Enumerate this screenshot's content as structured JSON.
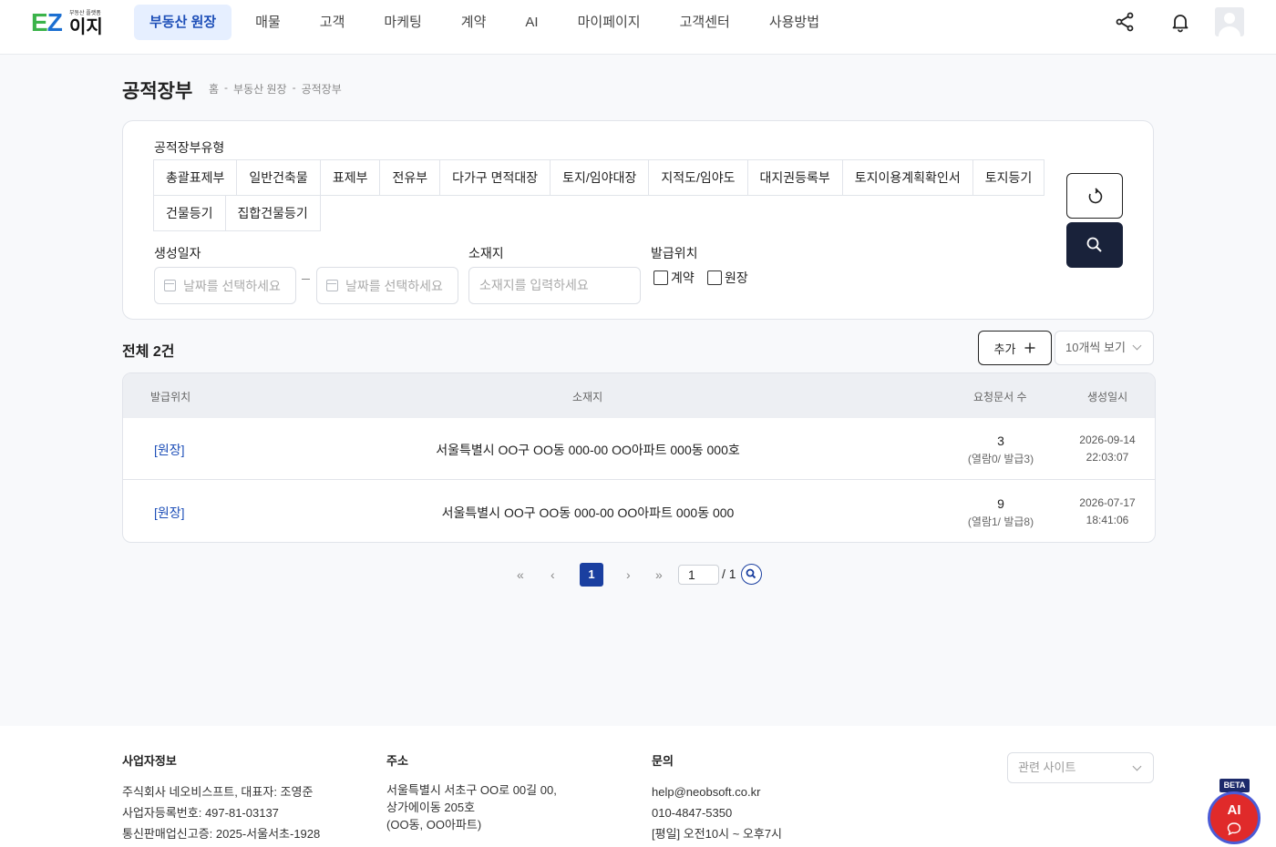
{
  "logo": {
    "en": "EZ",
    "ko": "이지",
    "tagline": "부동산 플랫폼"
  },
  "nav": [
    "부동산 원장",
    "매물",
    "고객",
    "마케팅",
    "계약",
    "AI",
    "마이페이지",
    "고객센터",
    "사용방법"
  ],
  "header_icons": [
    "share-icon",
    "bell-icon",
    "avatar-icon"
  ],
  "page": {
    "title": "공적장부",
    "breadcrumb": [
      "홈",
      "-",
      "부동산 원장",
      "-",
      "공적장부"
    ]
  },
  "filters": {
    "type_label": "공적장부유형",
    "types_row1": [
      "총괄표제부",
      "일반건축물",
      "표제부",
      "전유부",
      "다가구 면적대장",
      "토지/임야대장",
      "지적도/임야도",
      "대지권등록부",
      "토지이용계획확인서",
      "토지등기"
    ],
    "types_row2": [
      "건물등기",
      "집합건물등기"
    ],
    "date_label": "생성일자",
    "date_placeholder": "날짜를 선택하세요",
    "location_label": "소재지",
    "location_placeholder": "소재지를 입력하세요",
    "issue_label": "발급위치",
    "issue_options": [
      "계약",
      "원장"
    ]
  },
  "list": {
    "total": "전체 2건",
    "add_label": "추가",
    "page_size": "10개씩 보기"
  },
  "table": {
    "headers": [
      "발급위치",
      "소재지",
      "요청문서 수",
      "생성일시"
    ],
    "rows": [
      {
        "location": "[원장]",
        "address": "서울특별시 OO구 OO동 000-00 OO아파트 000동 000호",
        "count": "3",
        "count_detail": "(열람0/ 발급3)",
        "date": "2026-09-14",
        "time": "22:03:07"
      },
      {
        "location": "[원장]",
        "address": "서울특별시 OO구 OO동 000-00 OO아파트 000동 000",
        "count": "9",
        "count_detail": "(열람1/ 발급8)",
        "date": "2026-07-17",
        "time": "18:41:06"
      }
    ]
  },
  "pagination": {
    "first": "«",
    "prev": "‹",
    "current": "1",
    "next": "›",
    "last": "»",
    "input": "1",
    "of": "/ 1"
  },
  "footer": {
    "business_head": "사업자정보",
    "business_lines": [
      "주식회사 네오비스프트, 대표자: 조영준",
      "사업자등록번호: 497-81-03137",
      "통신판매업신고증: 2025-서울서초-1928"
    ],
    "address_head": "주소",
    "address_lines": [
      "서울특별시 서초구 OO로 00길 00,",
      "상가에이동 205호",
      "(OO동, OO아파트)"
    ],
    "contact_head": "문의",
    "contact_lines": [
      "help@neobsoft.co.kr",
      "010-4847-5350",
      "[평일] 오전10시 ~ 오후7시"
    ],
    "related_sites": "관련 사이트"
  },
  "ai_widget": {
    "badge": "BETA",
    "label": "AI"
  },
  "colors": {
    "brand_green": "#3bb34a",
    "brand_blue": "#1c6fd1",
    "accent": "#1a3fa0",
    "dark_button": "#19223a",
    "ai_red": "#e02a2a"
  }
}
